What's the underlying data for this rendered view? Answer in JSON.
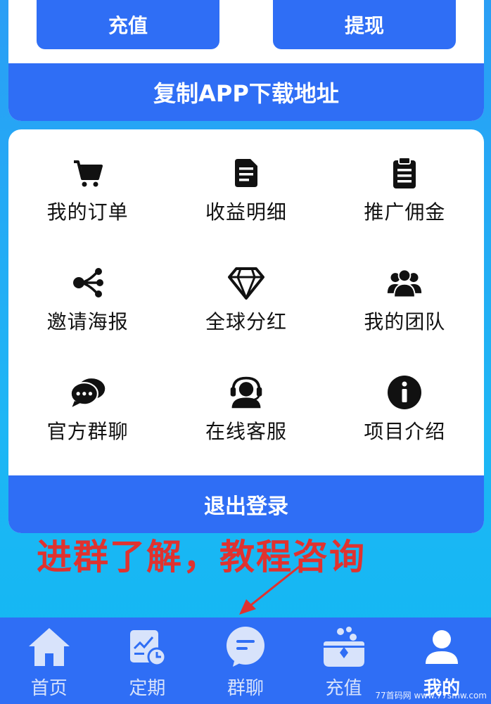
{
  "top": {
    "recharge_label": "充值",
    "withdraw_label": "提现",
    "copy_app_label": "复制APP下载地址"
  },
  "menu": {
    "items": [
      {
        "label": "我的订单",
        "icon": "cart-icon"
      },
      {
        "label": "收益明细",
        "icon": "document-icon"
      },
      {
        "label": "推广佣金",
        "icon": "clipboard-icon"
      },
      {
        "label": "邀请海报",
        "icon": "share-icon"
      },
      {
        "label": "全球分红",
        "icon": "diamond-icon"
      },
      {
        "label": "我的团队",
        "icon": "team-icon"
      },
      {
        "label": "官方群聊",
        "icon": "chat-icon"
      },
      {
        "label": "在线客服",
        "icon": "headset-icon"
      },
      {
        "label": "项目介绍",
        "icon": "info-icon"
      }
    ],
    "logout_label": "退出登录"
  },
  "annotation": "进群了解，教程咨询",
  "nav": {
    "items": [
      {
        "label": "首页",
        "icon": "home-icon"
      },
      {
        "label": "定期",
        "icon": "schedule-icon"
      },
      {
        "label": "群聊",
        "icon": "group-chat-icon"
      },
      {
        "label": "充值",
        "icon": "recharge-icon"
      },
      {
        "label": "我的",
        "icon": "user-icon"
      }
    ],
    "active_index": 4
  },
  "watermark": "77首码网 www.77smw.com",
  "colors": {
    "accent": "#2f6ef5",
    "background": "#1eb6f5",
    "annotation": "#e0322f"
  }
}
